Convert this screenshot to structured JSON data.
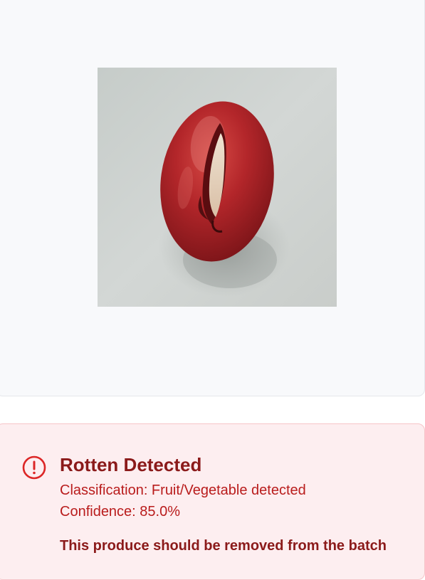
{
  "result": {
    "title": "Rotten Detected",
    "classification": "Classification: Fruit/Vegetable detected",
    "confidence": "Confidence: 85.0%",
    "action": "This produce should be removed from the batch",
    "status_icon": "exclamation-circle-icon",
    "status_color": "#dc2626"
  },
  "image": {
    "subject": "red grape with split skin",
    "background_color": "#cfd4d1",
    "fruit_color": "#b8282a"
  }
}
